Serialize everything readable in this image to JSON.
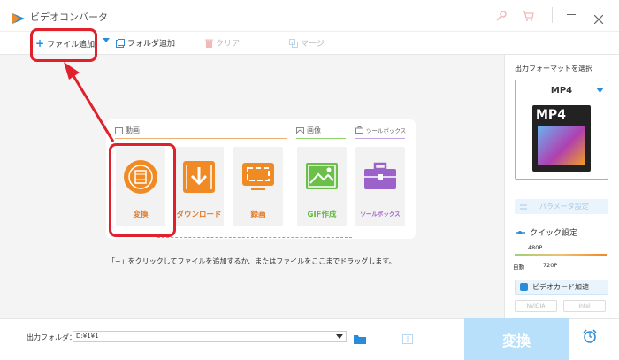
{
  "window": {
    "title": "ビデオコンバータ"
  },
  "toolbar": {
    "add_file": "ファイル追加",
    "add_folder": "フォルダ追加",
    "clear": "クリア",
    "merge": "マージ"
  },
  "sections": {
    "video": "動画",
    "image": "画像",
    "toolbox": "ツールボックス"
  },
  "tiles": [
    {
      "label": "変換"
    },
    {
      "label": "ダウンロード"
    },
    {
      "label": "録画"
    },
    {
      "label": "GIF作成"
    },
    {
      "label": "ツールボックス"
    }
  ],
  "hint": "「+」をクリックしてファイルを追加するか、またはファイルをここまでドラッグします。",
  "right_panel": {
    "title": "出力フォーマットを選択",
    "format": "MP4",
    "format_thumb_text": "MP4",
    "param_button": "パラメータ設定",
    "quick_settings": "クイック設定",
    "slider_top": "480P",
    "slider_auto": "自動",
    "slider_bottom": "720P",
    "gpu_button": "ビデオカード加速",
    "chip_nvidia": "NVIDIA",
    "chip_intel": "Intel"
  },
  "bottom": {
    "output_label": "出力フォルダ：",
    "output_path": "D:¥1¥1",
    "convert": "変換"
  },
  "colors": {
    "accent": "#2a8bd8",
    "orange": "#e07b2b",
    "green": "#6cc04a",
    "purple": "#9b63c9",
    "highlight": "#e0202a"
  }
}
